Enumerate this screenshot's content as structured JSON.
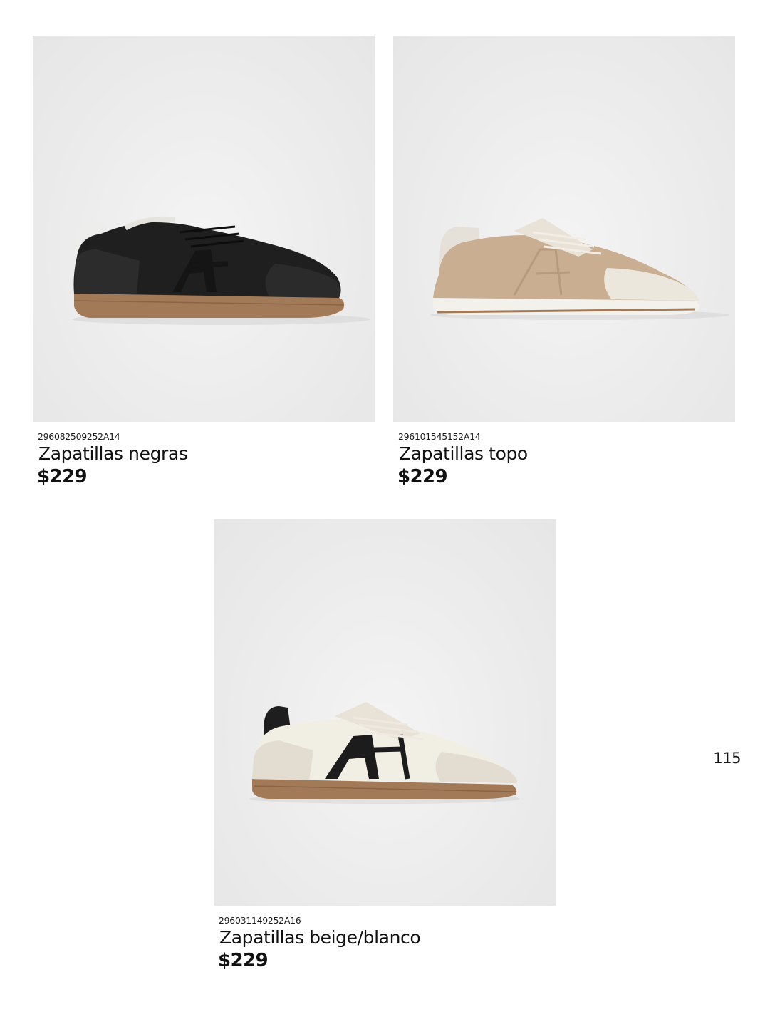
{
  "products": [
    {
      "sku": "296082509252A14",
      "name": "Zapatillas negras",
      "price": "$229",
      "image": "black-sneaker-image"
    },
    {
      "sku": "296101545152A14",
      "name": "Zapatillas topo",
      "price": "$229",
      "image": "taupe-sneaker-image"
    },
    {
      "sku": "296031149252A16",
      "name": "Zapatillas beige/blanco",
      "price": "$229",
      "image": "beige-white-sneaker-image"
    }
  ],
  "page_number": "115",
  "colors": {
    "photo_background": "#ececec",
    "text": "#111111",
    "gum_sole": "#a37a57",
    "black_leather": "#1e1e1e",
    "taupe_suede": "#c9ae91",
    "cream_leather": "#f1efe4"
  }
}
